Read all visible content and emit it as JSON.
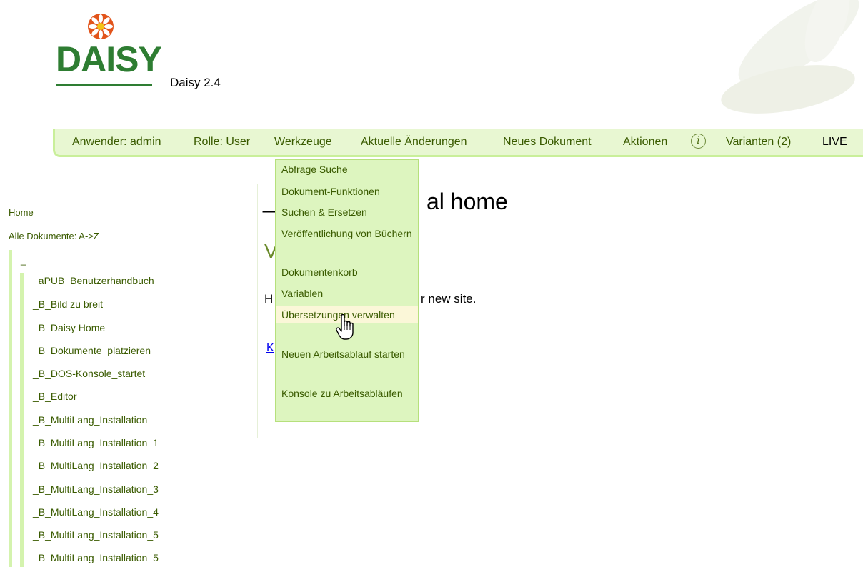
{
  "header": {
    "logo_text": "DAISY",
    "version": "Daisy 2.4"
  },
  "navbar": {
    "user": "Anwender: admin",
    "role": "Rolle: User",
    "tools": "Werkzeuge",
    "recent_changes": "Aktuelle Änderungen",
    "new_document": "Neues Dokument",
    "actions": "Aktionen",
    "info_icon": "i",
    "variants": "Varianten (2)",
    "live": "LIVE"
  },
  "tools_menu": [
    "Abfrage Suche",
    "Dokument-Funktionen",
    "Suchen & Ersetzen",
    "Veröffentlichung von Büchern",
    "Dokumentenkorb",
    "Variablen",
    "Übersetzungen verwalten",
    "Neuen Arbeitsablauf starten",
    "Konsole zu Arbeitsabläufen"
  ],
  "leftnav": {
    "home": "Home",
    "all_documents": "Alle Dokumente: A->Z",
    "root": "_",
    "items": [
      "_aPUB_Benutzerhandbuch",
      "_B_Bild zu breit",
      "_B_Daisy Home",
      "_B_Dokumente_platzieren",
      "_B_DOS-Konsole_startet",
      "_B_Editor",
      "_B_MultiLang_Installation",
      "_B_MultiLang_Installation_1",
      "_B_MultiLang_Installation_2",
      "_B_MultiLang_Installation_3",
      "_B_MultiLang_Installation_4",
      "_B_MultiLang_Installation_5",
      "_B_MultiLang_Installation_5"
    ]
  },
  "content": {
    "title_prefix": "_",
    "title_visible": "al home",
    "subheading_visible": "V",
    "body_prefix": "H",
    "body_visible": "r new site.",
    "link_visible": "K"
  }
}
